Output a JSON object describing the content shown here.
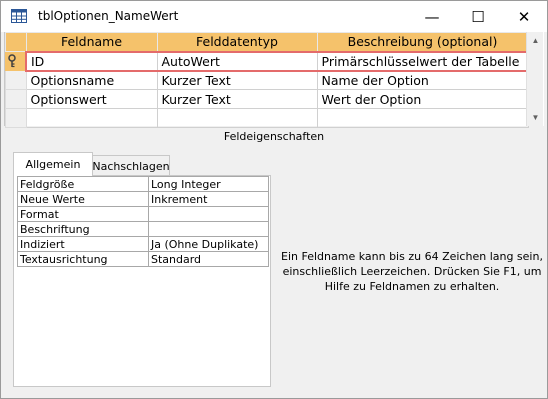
{
  "window": {
    "title": "tblOptionen_NameWert",
    "minimize_glyph": "—",
    "maximize_glyph": "☐",
    "close_glyph": "✕"
  },
  "grid": {
    "headers": [
      "Feldname",
      "Felddatentyp",
      "Beschreibung (optional)"
    ],
    "rows": [
      [
        "ID",
        "AutoWert",
        "Primärschlüsselwert der Tabelle"
      ],
      [
        "Optionsname",
        "Kurzer Text",
        "Name der Option"
      ],
      [
        "Optionswert",
        "Kurzer Text",
        "Wert der Option"
      ],
      [
        "",
        "",
        ""
      ]
    ],
    "primary_key_row": 0
  },
  "section_label": "Feldeigenschaften",
  "tabs": [
    "Allgemein",
    "Nachschlagen"
  ],
  "properties": [
    [
      "Feldgröße",
      "Long Integer"
    ],
    [
      "Neue Werte",
      "Inkrement"
    ],
    [
      "Format",
      ""
    ],
    [
      "Beschriftung",
      ""
    ],
    [
      "Indiziert",
      "Ja (Ohne Duplikate)"
    ],
    [
      "Textausrichtung",
      "Standard"
    ]
  ],
  "help_text": "Ein Feldname kann bis zu 64 Zeichen lang sein, einschließlich Leerzeichen. Drücken Sie F1, um Hilfe zu Feldnamen zu erhalten.",
  "colors": {
    "header": "#f5c26b",
    "current_row_border": "#e46b6b",
    "title_icon": "#2b5797"
  },
  "icons": {
    "table": "table-icon",
    "key": "primary-key-icon"
  }
}
